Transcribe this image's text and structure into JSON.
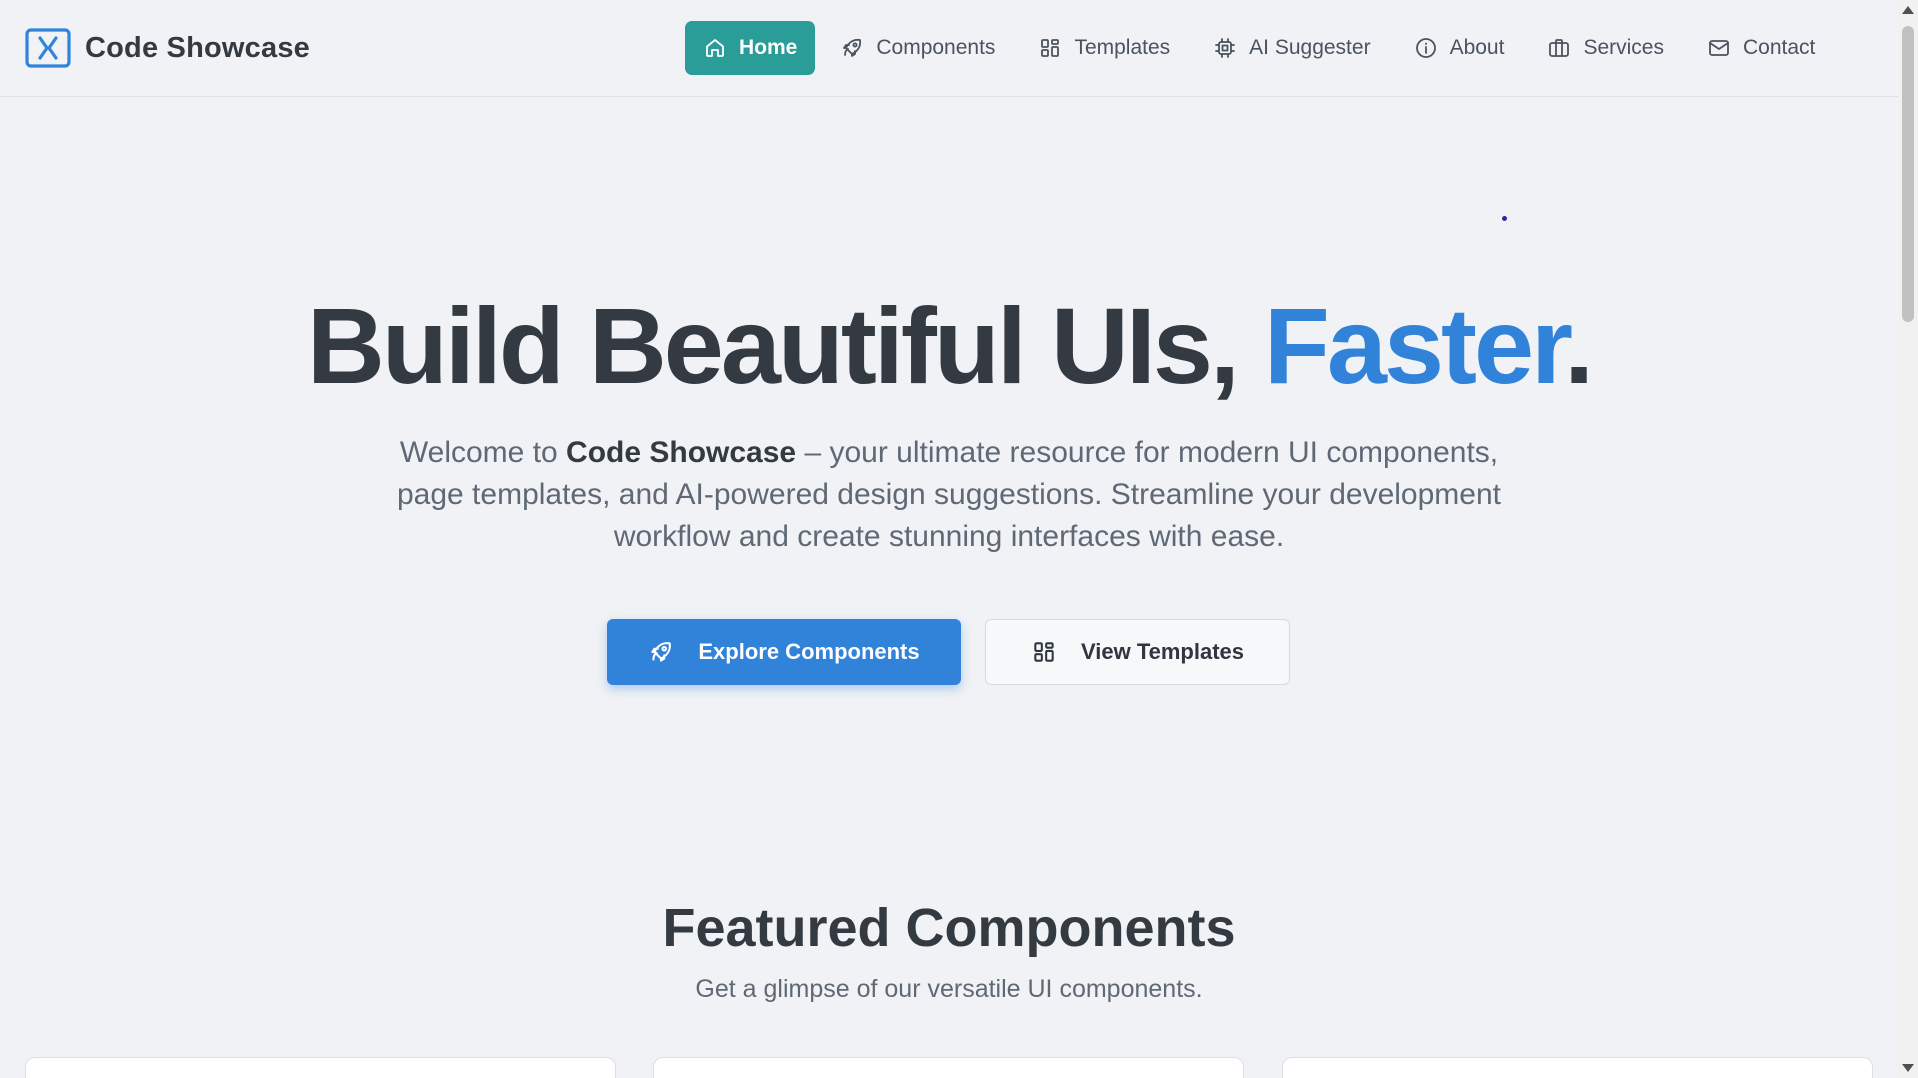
{
  "brand": {
    "name": "Code Showcase",
    "logo_icon": "code-brackets-icon",
    "accent": "#3182d9"
  },
  "nav": {
    "items": [
      {
        "label": "Home",
        "icon": "home-icon",
        "active": true
      },
      {
        "label": "Components",
        "icon": "rocket-icon",
        "active": false
      },
      {
        "label": "Templates",
        "icon": "grid-icon",
        "active": false
      },
      {
        "label": "AI Suggester",
        "icon": "cpu-icon",
        "active": false
      },
      {
        "label": "About",
        "icon": "info-icon",
        "active": false
      },
      {
        "label": "Services",
        "icon": "briefcase-icon",
        "active": false
      },
      {
        "label": "Contact",
        "icon": "mail-icon",
        "active": false
      }
    ],
    "active_color": "#2a9d98"
  },
  "hero": {
    "title_main": "Build Beautiful UIs, ",
    "title_accent": "Faster",
    "title_end": ".",
    "desc_pre": "Welcome to ",
    "desc_brand": "Code Showcase",
    "desc_post": " – your ultimate resource for modern UI components, page templates, and AI-powered design suggestions. Streamline your development workflow and create stunning interfaces with ease.",
    "primary_cta": "Explore Components",
    "secondary_cta": "View Templates"
  },
  "featured": {
    "title": "Featured Components",
    "subtitle": "Get a glimpse of our versatile UI components."
  }
}
